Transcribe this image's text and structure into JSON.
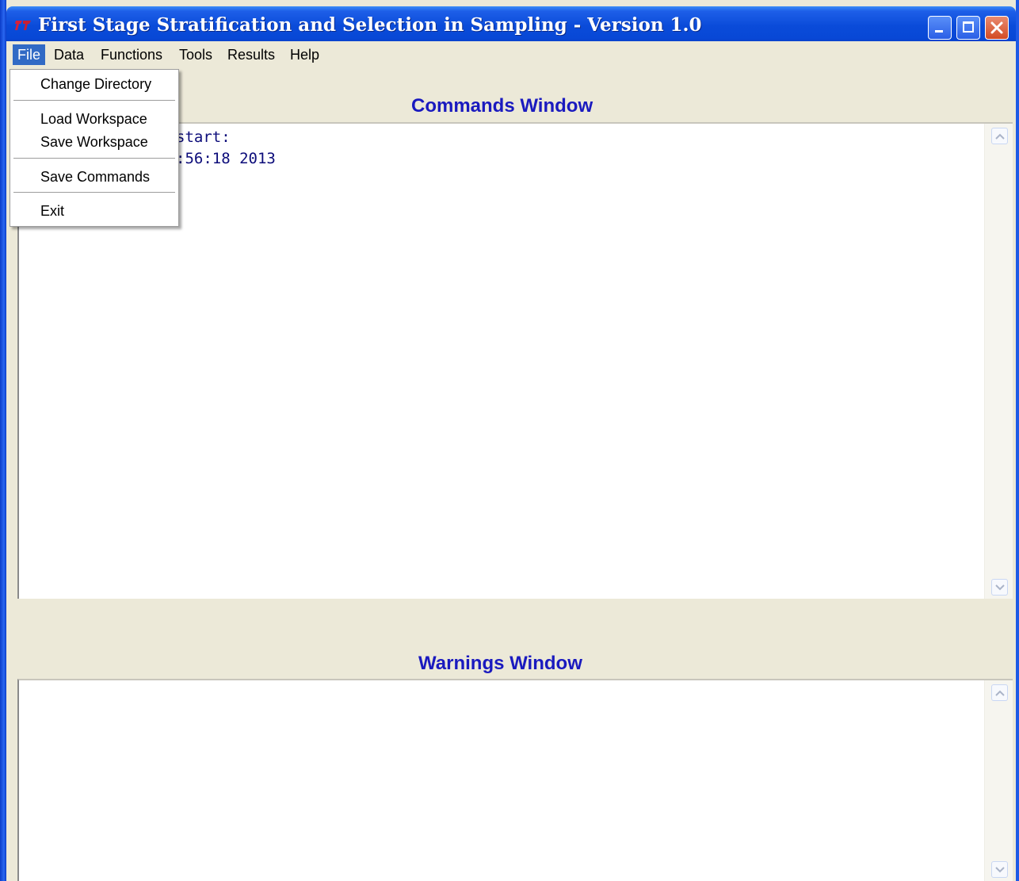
{
  "window": {
    "title": "First Stage Stratification and Selection in Sampling - Version 1.0"
  },
  "menubar": {
    "items": [
      "File",
      "Data",
      "Functions",
      "Tools",
      "Results",
      "Help"
    ],
    "active": "File"
  },
  "file_menu": {
    "items": [
      "Change Directory",
      "Load Workspace",
      "Save Workspace",
      "Save Commands",
      "Exit"
    ]
  },
  "commands_window": {
    "title": "Commands Window",
    "lines": [
      "start:",
      ":56:18 2013"
    ]
  },
  "warnings_window": {
    "title": "Warnings Window"
  },
  "colors": {
    "titlebar": "#0a4bd9",
    "heading": "#1a1abf",
    "menu_highlight": "#316ac5",
    "background": "#ece9d8"
  },
  "icons": [
    "app-icon",
    "minimize-icon",
    "maximize-icon",
    "close-icon",
    "scroll-up-icon",
    "scroll-down-icon"
  ]
}
